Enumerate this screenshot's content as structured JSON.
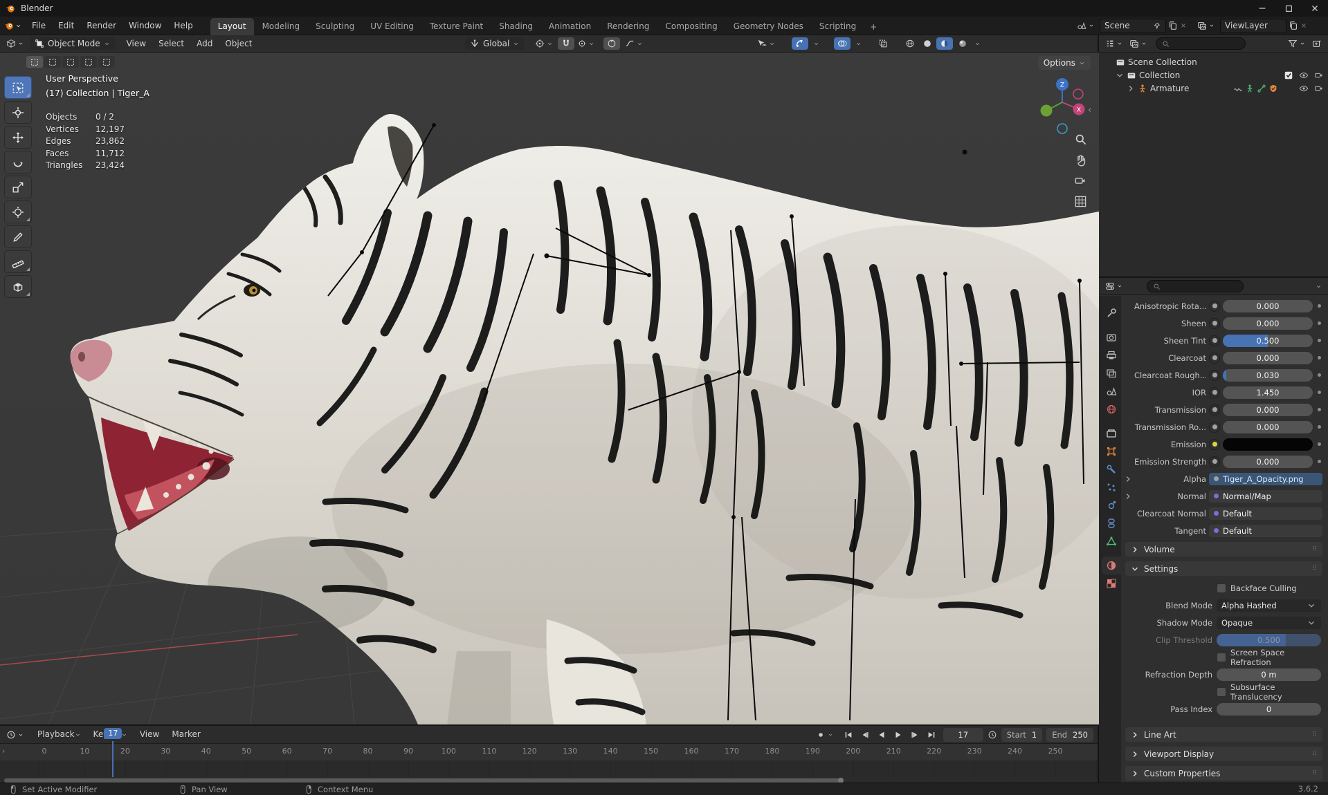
{
  "window": {
    "title": "Blender",
    "controls": [
      "minimize",
      "maximize",
      "close"
    ]
  },
  "menubar": {
    "menus": [
      "File",
      "Edit",
      "Render",
      "Window",
      "Help"
    ],
    "workspaces": {
      "tabs": [
        "Layout",
        "Modeling",
        "Sculpting",
        "UV Editing",
        "Texture Paint",
        "Shading",
        "Animation",
        "Rendering",
        "Compositing",
        "Geometry Nodes",
        "Scripting"
      ],
      "active": "Layout",
      "add": "+"
    },
    "scene_selector": {
      "value": "Scene"
    },
    "view_layer_selector": {
      "value": "ViewLayer"
    }
  },
  "viewport": {
    "header": {
      "mode": "Object Mode",
      "menus": [
        "View",
        "Select",
        "Add",
        "Object"
      ],
      "orientation": "Global"
    },
    "options_button": "Options",
    "overlay": {
      "view_label": "User Perspective",
      "context_label": "(17) Collection | Tiger_A",
      "stats": [
        [
          "Objects",
          "0 / 2"
        ],
        [
          "Vertices",
          "12,197"
        ],
        [
          "Edges",
          "23,862"
        ],
        [
          "Faces",
          "11,712"
        ],
        [
          "Triangles",
          "23,424"
        ]
      ]
    },
    "toolbar": [
      "select-box",
      "cursor",
      "move",
      "rotate",
      "scale",
      "transform",
      "annotate",
      "measure",
      "add-cube"
    ],
    "gizmo": {
      "z": "Z",
      "x": "X"
    },
    "nav_icons": [
      "zoom",
      "pan-hand",
      "camera-view",
      "grid-ortho"
    ]
  },
  "outliner": {
    "search_placeholder": "",
    "rows": [
      {
        "label": "Scene Collection",
        "depth": 0,
        "icon": "collection",
        "caret": "none",
        "badges": [],
        "toggles": []
      },
      {
        "label": "Collection",
        "depth": 1,
        "icon": "collection",
        "caret": "down",
        "badges": [],
        "toggles": [
          "checkbox",
          "eye",
          "camera"
        ]
      },
      {
        "label": "Armature",
        "depth": 2,
        "icon": "armature",
        "caret": "right",
        "badges": [
          "action",
          "pose",
          "bone",
          "shield"
        ],
        "toggles": [
          "eye",
          "camera"
        ]
      }
    ]
  },
  "properties": {
    "search_placeholder": "",
    "tabs": [
      {
        "id": "tool"
      },
      {
        "id": "render"
      },
      {
        "id": "output"
      },
      {
        "id": "view-layer"
      },
      {
        "id": "scene"
      },
      {
        "id": "world"
      },
      {
        "id": "collection"
      },
      {
        "id": "object"
      },
      {
        "id": "modifiers"
      },
      {
        "id": "particles"
      },
      {
        "id": "physics"
      },
      {
        "id": "constraints"
      },
      {
        "id": "object-data"
      },
      {
        "id": "material",
        "active": true
      },
      {
        "id": "texture"
      }
    ],
    "rows": [
      {
        "label": "Anisotropic Rota...",
        "value": "0.000",
        "kind": "slider",
        "fill": 0
      },
      {
        "label": "Sheen",
        "value": "0.000",
        "kind": "slider",
        "fill": 0
      },
      {
        "label": "Sheen Tint",
        "value": "0.500",
        "kind": "slider",
        "fill": 50
      },
      {
        "label": "Clearcoat",
        "value": "0.000",
        "kind": "slider",
        "fill": 0
      },
      {
        "label": "Clearcoat Rough...",
        "value": "0.030",
        "kind": "slider",
        "fill": 4
      },
      {
        "label": "IOR",
        "value": "1.450",
        "kind": "slider",
        "fill": 0
      },
      {
        "label": "Transmission",
        "value": "0.000",
        "kind": "slider",
        "fill": 0
      },
      {
        "label": "Transmission Ro...",
        "value": "0.000",
        "kind": "slider",
        "fill": 0
      },
      {
        "label": "Emission",
        "value": "",
        "kind": "color"
      },
      {
        "label": "Emission Strength",
        "value": "0.000",
        "kind": "slider",
        "fill": 0
      },
      {
        "label": "Alpha",
        "value": "Tiger_A_Opacity.png",
        "kind": "texture",
        "arrow": true
      },
      {
        "label": "Normal",
        "value": "Normal/Map",
        "kind": "link",
        "arrow": true
      },
      {
        "label": "Clearcoat Normal",
        "value": "Default",
        "kind": "link"
      },
      {
        "label": "Tangent",
        "value": "Default",
        "kind": "link"
      }
    ],
    "volume_section": "Volume",
    "settings_section": "Settings",
    "settings_rows": [
      {
        "type": "checkbox",
        "label": "Backface Culling",
        "checked": false
      },
      {
        "type": "select",
        "label": "Blend Mode",
        "value": "Alpha Hashed"
      },
      {
        "type": "select",
        "label": "Shadow Mode",
        "value": "Opaque"
      },
      {
        "type": "slider_disabled",
        "label": "Clip Threshold",
        "value": "0.500",
        "fill": 66
      },
      {
        "type": "checkbox",
        "label": "Screen Space Refraction",
        "checked": false
      },
      {
        "type": "field",
        "label": "Refraction Depth",
        "value": "0 m"
      },
      {
        "type": "checkbox",
        "label": "Subsurface Translucency",
        "checked": false
      },
      {
        "type": "field",
        "label": "Pass Index",
        "value": "0"
      }
    ],
    "collapsed_sections": [
      "Line Art",
      "Viewport Display",
      "Custom Properties"
    ]
  },
  "timeline": {
    "menus": [
      "Playback",
      "Keying",
      "View",
      "Marker"
    ],
    "ruler": {
      "min": 0,
      "max": 250,
      "step": 10,
      "current": 17
    },
    "current_frame": "17",
    "start": {
      "label": "Start",
      "value": "1"
    },
    "end": {
      "label": "End",
      "value": "250"
    }
  },
  "statusbar": {
    "hints": [
      {
        "mouse": "left",
        "label": "Set Active Modifier"
      },
      {
        "mouse": "middle",
        "label": "Pan View"
      },
      {
        "mouse": "right",
        "label": "Context Menu"
      }
    ],
    "version": "3.6.2"
  },
  "colors": {
    "accent": "#4772b3",
    "object_orange": "#e0853c",
    "data_green": "#4fbf77",
    "world_red": "#cf5f5f",
    "modifier_blue": "#628ecb",
    "material_pink": "#d97b7b"
  }
}
